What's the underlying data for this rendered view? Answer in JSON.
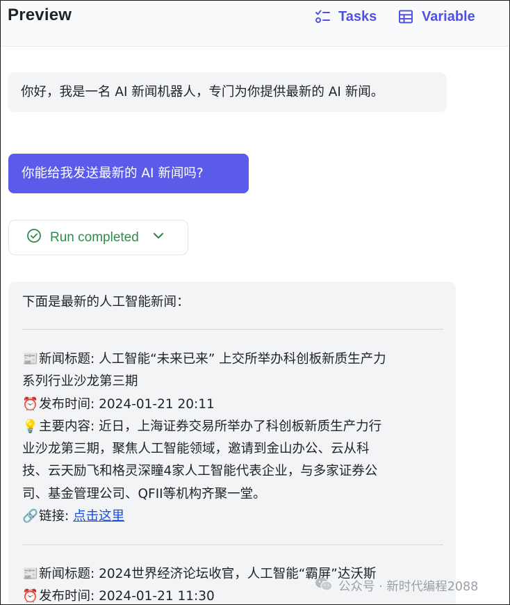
{
  "header": {
    "title": "Preview",
    "tasks_label": "Tasks",
    "variable_label": "Variable",
    "accent": "#4f52e0"
  },
  "chat": {
    "bot_greeting": "你好，我是一名 AI 新闻机器人，专门为你提供最新的 AI 新闻。",
    "user_message": "你能给我发送最新的 AI 新闻吗?",
    "user_bubble_color": "#5b5bea",
    "run_status": "Run completed",
    "run_status_color": "#2f8a4a"
  },
  "answer": {
    "intro": "下面是最新的人工智能新闻：",
    "news": [
      {
        "title_icon": "📰",
        "title_line1": "新闻标题: 人工智能“未来已来” 上交所举办科创板新质生产力",
        "title_line2": "系列行业沙龙第三期",
        "time_icon": "⏰",
        "time": "发布时间: 2024-01-21 20:11",
        "content_icon": "💡",
        "content_line1": "主要内容: 近日，上海证券交易所举办了科创板新质生产力行",
        "content_line2": "业沙龙第三期，聚焦人工智能领域，邀请到金山办公、云从科",
        "content_line3": "技、云天励飞和格灵深瞳4家人工智能代表企业，与多家证券公",
        "content_line4": "司、基金管理公司、QFII等机构齐聚一堂。",
        "link_icon": "🔗",
        "link_prefix": "链接: ",
        "link_text": "点击这里"
      },
      {
        "title_icon": "📰",
        "title_line1": "新闻标题: 2024世界经济论坛收官，人工智能“霸屏”达沃斯",
        "time_icon": "⏰",
        "time": "发布时间: 2024-01-21 11:30"
      }
    ]
  },
  "watermark": {
    "text": "公众号 · 新时代编程2088"
  }
}
